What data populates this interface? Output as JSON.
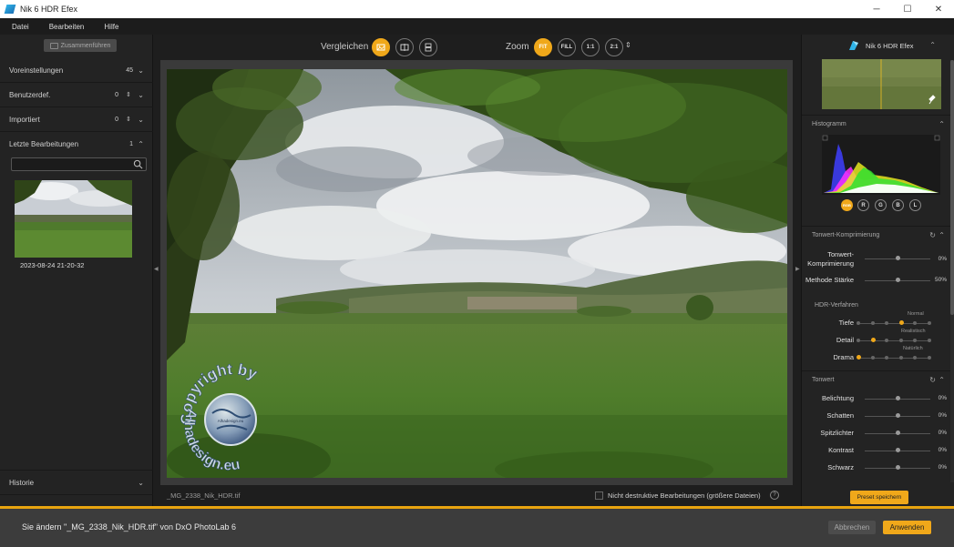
{
  "window": {
    "title": "Nik 6 HDR Efex",
    "min": "─",
    "max": "☐",
    "close": "✕"
  },
  "menu": [
    "Datei",
    "Bearbeiten",
    "Hilfe"
  ],
  "left": {
    "merge_button": "Zusammenführen",
    "sections": [
      {
        "label": "Voreinstellungen",
        "count": "45",
        "arrows": ""
      },
      {
        "label": "Benutzerdef.",
        "count": "0",
        "arrows": "⇕"
      },
      {
        "label": "Importiert",
        "count": "0",
        "arrows": "⇕"
      },
      {
        "label": "Letzte Bearbeitungen",
        "count": "1",
        "arrows": ""
      }
    ],
    "recent_item": "2023-08-24 21-20-32",
    "history_label": "Historie"
  },
  "center": {
    "compare_label": "Vergleichen",
    "zoom_label": "Zoom",
    "zoom_buttons": [
      "FIT",
      "FILL",
      "1:1",
      "2:1"
    ],
    "zoom_more": "⇕",
    "filename": "_MG_2338_Nik_HDR.tif",
    "nondestructive_label": "Nicht destruktive Bearbeitungen (größere Dateien)",
    "help": "?",
    "watermark": {
      "line1": "Copyright by",
      "line2": "Alhadesign.eu",
      "globe_text": "Alhadesign.eu"
    }
  },
  "right": {
    "logo_text": "Nik 6 HDR Efex",
    "histogram_label": "Histogramm",
    "channels": [
      "RGB",
      "R",
      "G",
      "B",
      "L"
    ],
    "tonewert_comp_label": "Tonwert-Komprimierung",
    "comp_sliders": [
      {
        "name": "Tonwert-\nKomprimierung",
        "value": "0%",
        "fraction": 0.5
      },
      {
        "name": "Methode Stärke",
        "value": "50%",
        "fraction": 0.5
      }
    ],
    "hdr_label": "HDR-Verfahren",
    "hdr_rows": [
      {
        "name": "Tiefe",
        "tag": "Normal",
        "index": 3
      },
      {
        "name": "Detail",
        "tag": "Realistisch",
        "index": 1
      },
      {
        "name": "Drama",
        "tag": "Natürlich",
        "index": 0
      }
    ],
    "tonwert_label": "Tonwert",
    "tonwert_sliders": [
      {
        "name": "Belichtung",
        "value": "0%",
        "fraction": 0.5
      },
      {
        "name": "Schatten",
        "value": "0%",
        "fraction": 0.5
      },
      {
        "name": "Spitzlichter",
        "value": "0%",
        "fraction": 0.5
      },
      {
        "name": "Kontrast",
        "value": "0%",
        "fraction": 0.5
      },
      {
        "name": "Schwarz",
        "value": "0%",
        "fraction": 0.5
      }
    ],
    "preset_button": "Preset speichern"
  },
  "bottom": {
    "message": "Sie ändern \"_MG_2338_Nik_HDR.tif\" von DxO PhotoLab 6",
    "cancel": "Abbrechen",
    "apply": "Anwenden"
  },
  "colors": {
    "accent": "#f0a81a",
    "panel": "#232323",
    "canvas": "#3a3a3a"
  }
}
